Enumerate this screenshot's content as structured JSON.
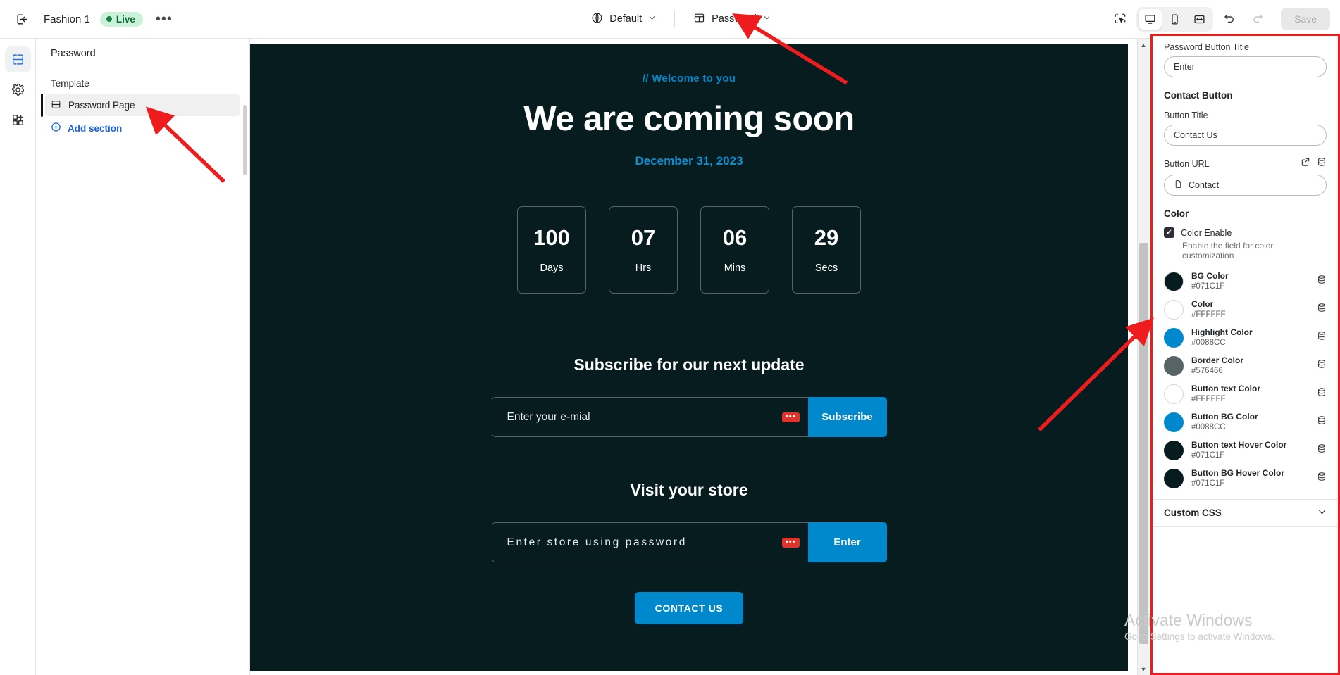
{
  "topbar": {
    "back_icon": "exit-icon",
    "shop_name": "Fashion 1",
    "status_badge": "Live",
    "more_label": "•••",
    "locale_selector": {
      "icon": "globe-icon",
      "label": "Default",
      "chevron": "⌄"
    },
    "page_selector": {
      "icon": "page-icon",
      "label": "Password",
      "chevron": "⌄"
    },
    "inspector_icon": "select-inspect-icon",
    "devices": [
      {
        "name": "desktop",
        "icon": "monitor-icon",
        "active": true
      },
      {
        "name": "mobile",
        "icon": "phone-icon",
        "active": false
      },
      {
        "name": "fullscreen",
        "icon": "fullwidth-icon",
        "active": false
      }
    ],
    "undo_icon": "undo-icon",
    "redo_icon": "redo-icon",
    "save_label": "Save"
  },
  "rail": {
    "items": [
      {
        "name": "sections",
        "icon": "sections-icon",
        "active": true
      },
      {
        "name": "settings",
        "icon": "gear-icon",
        "active": false
      },
      {
        "name": "apps",
        "icon": "apps-add-icon",
        "active": false
      }
    ]
  },
  "left_panel": {
    "header_title": "Password",
    "section_label": "Template",
    "items": [
      {
        "label": "Password Page",
        "icon": "section-icon",
        "selected": true
      }
    ],
    "add_section_label": "Add section",
    "add_section_icon": "plus-circle-icon"
  },
  "canvas": {
    "kicker": "// Welcome to you",
    "headline": "We are coming soon",
    "date": "December 31, 2023",
    "countdown": [
      {
        "value": "100",
        "label": "Days"
      },
      {
        "value": "07",
        "label": "Hrs"
      },
      {
        "value": "06",
        "label": "Mins"
      },
      {
        "value": "29",
        "label": "Secs"
      }
    ],
    "subscribe": {
      "title": "Subscribe for our next update",
      "placeholder": "Enter your e-mial",
      "button": "Subscribe",
      "marker": "•••"
    },
    "store": {
      "title": "Visit your store",
      "placeholder": "Enter store using password",
      "button": "Enter",
      "marker": "•••"
    },
    "contact_cta": "CONTACT US"
  },
  "right_panel": {
    "password_button_title_label": "Password Button Title",
    "password_button_title_value": "Enter",
    "contact_button_section": "Contact Button",
    "button_title_label": "Button Title",
    "button_title_value": "Contact Us",
    "button_url_label": "Button URL",
    "button_url_value": "Contact",
    "button_url_file_icon": "file-icon",
    "external_link_icon": "external-link-icon",
    "database_icon": "database-icon",
    "color_section": "Color",
    "color_enable_label": "Color Enable",
    "color_enable_checked": true,
    "color_enable_help": "Enable the field for color customization",
    "colors": [
      {
        "name": "BG Color",
        "hex": "#071C1F",
        "swatch": "#071C1F"
      },
      {
        "name": "Color",
        "hex": "#FFFFFF",
        "swatch": "#FFFFFF"
      },
      {
        "name": "Highlight Color",
        "hex": "#0088CC",
        "swatch": "#0088CC"
      },
      {
        "name": "Border Color",
        "hex": "#576466",
        "swatch": "#576466"
      },
      {
        "name": "Button text Color",
        "hex": "#FFFFFF",
        "swatch": "#FFFFFF"
      },
      {
        "name": "Button BG Color",
        "hex": "#0088CC",
        "swatch": "#0088CC"
      },
      {
        "name": "Button text Hover Color",
        "hex": "#071C1F",
        "swatch": "#071C1F"
      },
      {
        "name": "Button BG Hover Color",
        "hex": "#071C1F",
        "swatch": "#071C1F"
      }
    ],
    "custom_css_label": "Custom CSS",
    "custom_css_chevron": "⌄"
  },
  "watermark": {
    "title": "Activate Windows",
    "subtitle": "Go to Settings to activate Windows."
  },
  "theme": {
    "accent": "#0088CC",
    "canvas_bg": "#071C1F",
    "annotation_red": "#EE1C1C",
    "live_green": "#1A7F46"
  }
}
